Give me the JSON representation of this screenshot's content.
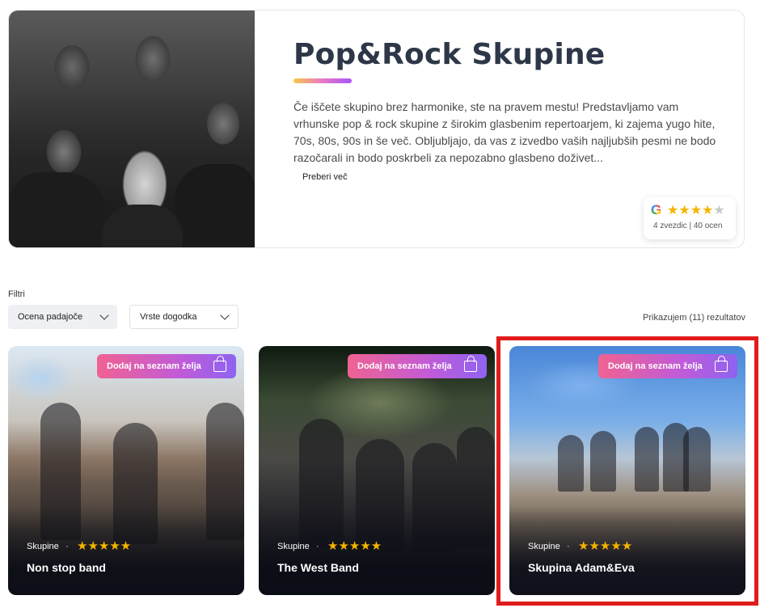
{
  "hero": {
    "title": "Pop&Rock Skupine",
    "description": "Če iščete skupino brez harmonike, ste na pravem mestu! Predstavljamo vam vrhunske pop & rock skupine z širokim glasbenim repertoarjem, ki zajema yugo hite, 70s, 80s, 90s in še več. Obljubljajo, da vas z izvedbo vaših najljubših pesmi ne bodo razočarali in bodo poskrbeli za nepozabno glasbeno doživet...",
    "read_more": "Preberi več",
    "google_rating": {
      "icon": "G",
      "stars": 4,
      "max_stars": 5,
      "text": "4 zvezdic | 40 ocen"
    }
  },
  "filters": {
    "label": "Filtri",
    "dropdowns": [
      {
        "label": "Ocena padajoče"
      },
      {
        "label": "Vrste dogodka"
      }
    ],
    "results_text": "Prikazujem (11) rezultatov"
  },
  "cards": [
    {
      "wishlist_label": "Dodaj na seznam želja",
      "category": "Skupine",
      "stars": 5,
      "title": "Non stop band"
    },
    {
      "wishlist_label": "Dodaj na seznam želja",
      "category": "Skupine",
      "stars": 5,
      "title": "The West Band"
    },
    {
      "wishlist_label": "Dodaj na seznam želja",
      "category": "Skupine",
      "stars": 5,
      "title": "Skupina Adam&Eva"
    }
  ],
  "colors": {
    "star": "#f6b400",
    "wishlist_gradient_start": "#f06292",
    "wishlist_gradient_end": "#8e63f0",
    "highlight": "#e01b1b",
    "title": "#2d3748"
  },
  "highlighted_card_index": 2,
  "star_glyph": "★★★★★",
  "google_stars": {
    "filled": "★★★★",
    "empty": "★"
  },
  "dot": "·"
}
